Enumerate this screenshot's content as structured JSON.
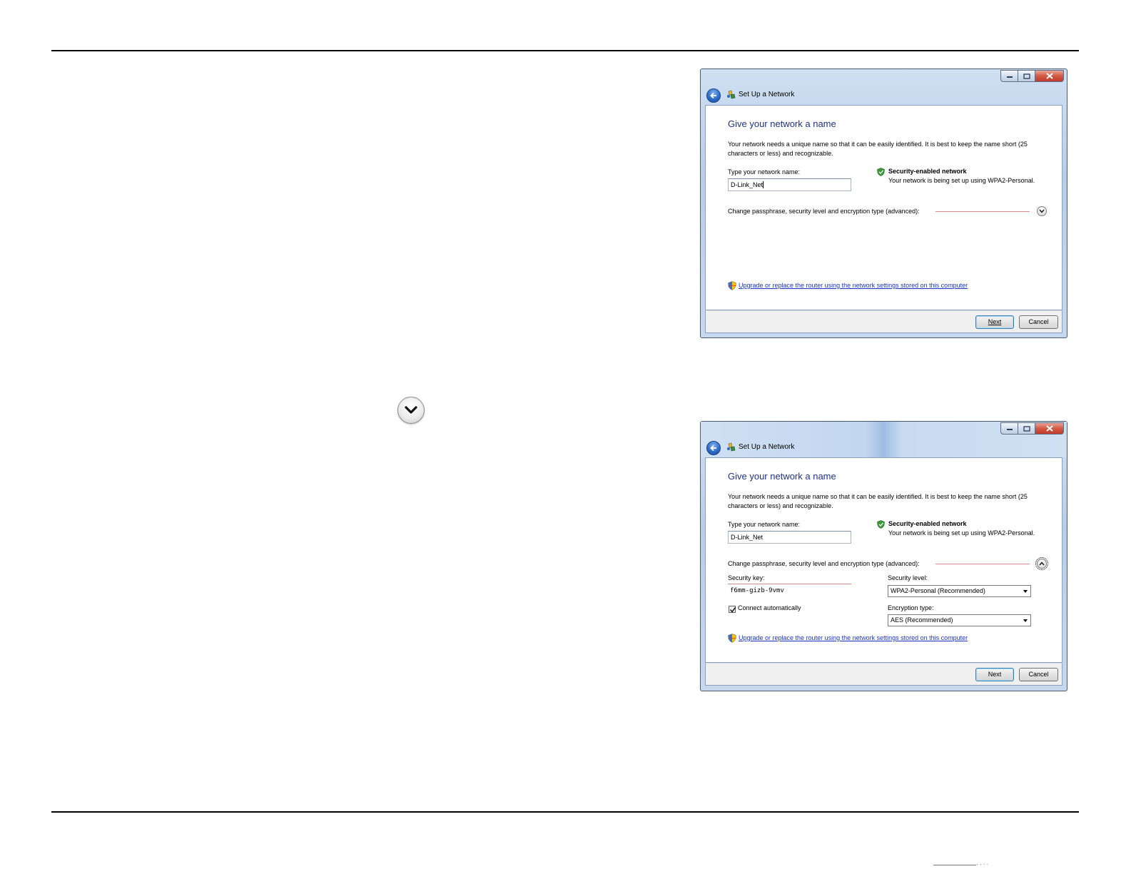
{
  "page": {
    "corner_mark": "· · · ·"
  },
  "dialogs": [
    {
      "title": "Set Up a Network",
      "heading": "Give your network a name",
      "description": "Your network needs a unique name so that it can be easily identified. It is best to keep the name short (25 characters or less) and recognizable.",
      "name_label": "Type your network name:",
      "name_value": "D-Link_Net",
      "security_title": "Security-enabled network",
      "security_sub": "Your network is being set up using WPA2-Personal.",
      "change_label": "Change passphrase, security level and encryption type (advanced):",
      "link": "Upgrade or replace the router using the network settings stored on this computer",
      "next": "Next",
      "cancel": "Cancel"
    },
    {
      "title": "Set Up a Network",
      "heading": "Give your network a name",
      "description": "Your network needs a unique name so that it can be easily identified. It is best to keep the name short (25 characters or less) and recognizable.",
      "name_label": "Type your network name:",
      "name_value": "D-Link_Net",
      "security_title": "Security-enabled network",
      "security_sub": "Your network is being set up using WPA2-Personal.",
      "change_label": "Change passphrase, security level and encryption type (advanced):",
      "security_key_label": "Security key:",
      "security_key_value": "f6mm-gizb-9vmv",
      "connect_auto_label": "Connect automatically",
      "connect_auto_checked": true,
      "security_level_label": "Security level:",
      "security_level_value": "WPA2-Personal (Recommended)",
      "encryption_label": "Encryption type:",
      "encryption_value": "AES (Recommended)",
      "link": "Upgrade or replace the router using the network settings stored on this computer",
      "next": "Next",
      "cancel": "Cancel"
    }
  ]
}
